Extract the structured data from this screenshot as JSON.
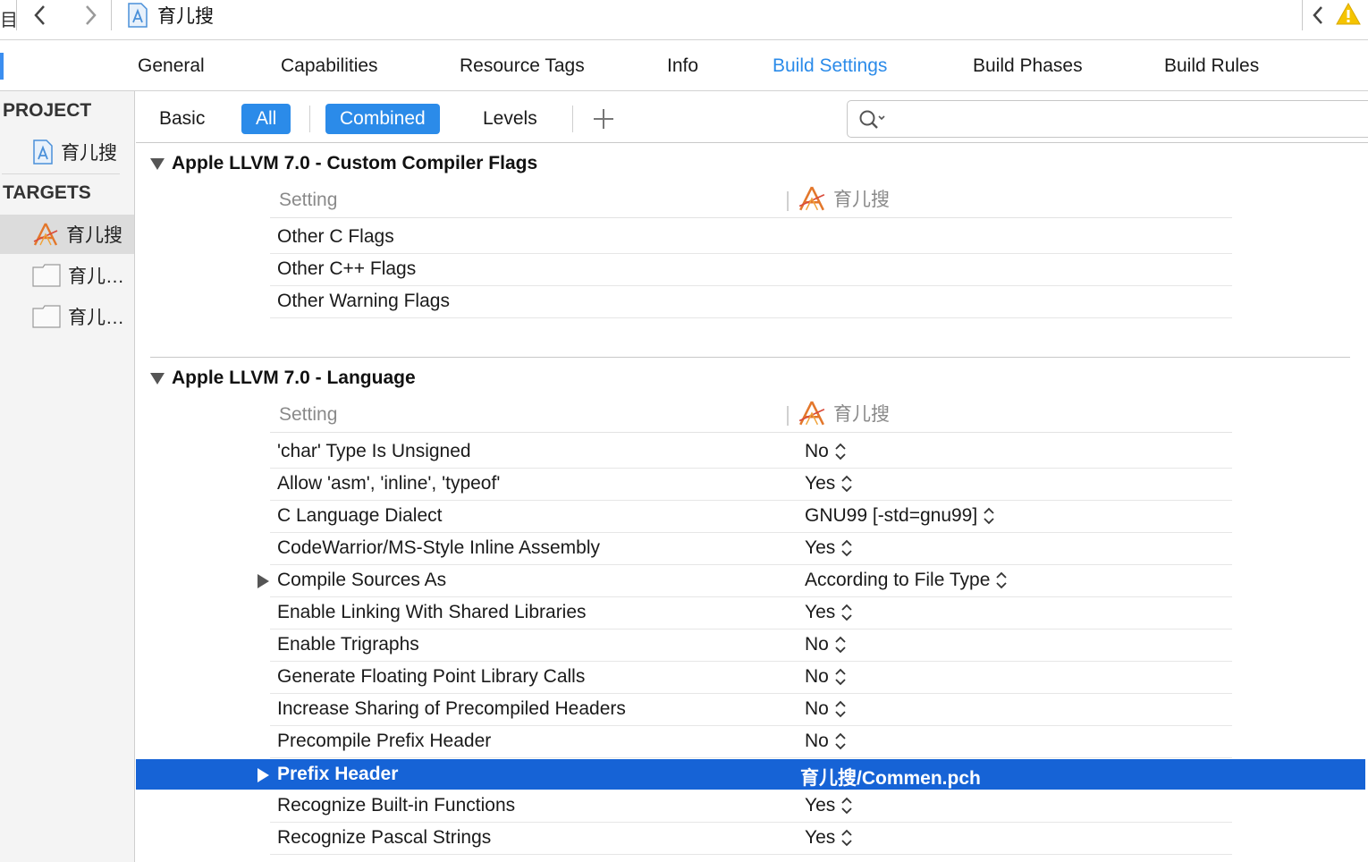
{
  "jumpbar": {
    "cut_glyph": "目",
    "project_name": "育儿搜",
    "nav_back_icon": "chevron-left-icon",
    "nav_forward_icon": "chevron-right-icon",
    "warning_icon": "warning-icon"
  },
  "tabs": [
    {
      "label": "General"
    },
    {
      "label": "Capabilities"
    },
    {
      "label": "Resource Tags"
    },
    {
      "label": "Info"
    },
    {
      "label": "Build Settings",
      "active": true
    },
    {
      "label": "Build Phases"
    },
    {
      "label": "Build Rules"
    }
  ],
  "sidebar": {
    "project_header": "PROJECT",
    "project_item": "育儿搜",
    "targets_header": "TARGETS",
    "targets": [
      {
        "label": "育儿搜",
        "selected": true
      },
      {
        "label": "育儿…"
      },
      {
        "label": "育儿…"
      }
    ]
  },
  "filterbar": {
    "basic": "Basic",
    "all": "All",
    "combined": "Combined",
    "levels": "Levels",
    "search_placeholder": ""
  },
  "sections": [
    {
      "title": "Apple LLVM 7.0 - Custom Compiler Flags",
      "col_setting": "Setting",
      "col_target": "育儿搜",
      "rows": [
        {
          "name": "Other C Flags",
          "value": ""
        },
        {
          "name": "Other C++ Flags",
          "value": ""
        },
        {
          "name": "Other Warning Flags",
          "value": ""
        }
      ]
    },
    {
      "title": "Apple LLVM 7.0 - Language",
      "col_setting": "Setting",
      "col_target": "育儿搜",
      "rows": [
        {
          "name": "'char' Type Is Unsigned",
          "value": "No"
        },
        {
          "name": "Allow 'asm', 'inline', 'typeof'",
          "value": "Yes"
        },
        {
          "name": "C Language Dialect",
          "value": "GNU99 [-std=gnu99]"
        },
        {
          "name": "CodeWarrior/MS-Style Inline Assembly",
          "value": "Yes"
        },
        {
          "name": "Compile Sources As",
          "value": "According to File Type"
        },
        {
          "name": "Enable Linking With Shared Libraries",
          "value": "Yes"
        },
        {
          "name": "Enable Trigraphs",
          "value": "No"
        },
        {
          "name": "Generate Floating Point Library Calls",
          "value": "No"
        },
        {
          "name": "Increase Sharing of Precompiled Headers",
          "value": "No"
        },
        {
          "name": "Precompile Prefix Header",
          "value": "No"
        },
        {
          "name": "Prefix Header",
          "value": "育儿搜/Commen.pch"
        },
        {
          "name": "Recognize Built-in Functions",
          "value": "Yes"
        },
        {
          "name": "Recognize Pascal Strings",
          "value": "Yes"
        }
      ]
    }
  ],
  "colors": {
    "accent": "#2b8be9",
    "selection": "#1663d6"
  }
}
